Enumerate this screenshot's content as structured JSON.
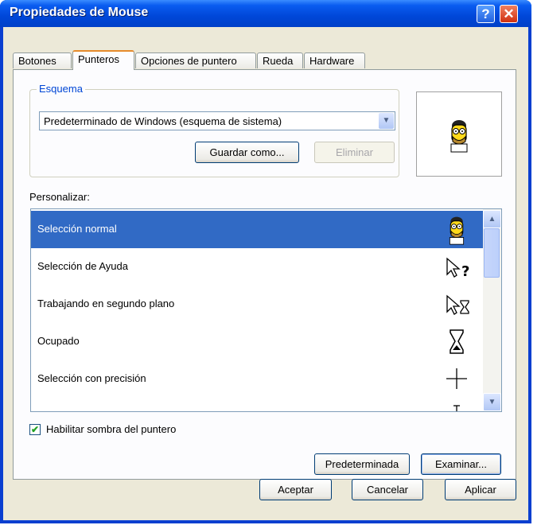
{
  "window": {
    "title": "Propiedades de Mouse"
  },
  "title_buttons": {
    "help": "?",
    "close": "✕"
  },
  "tabs": [
    {
      "label": "Botones"
    },
    {
      "label": "Punteros"
    },
    {
      "label": "Opciones de puntero"
    },
    {
      "label": "Rueda"
    },
    {
      "label": "Hardware"
    }
  ],
  "scheme": {
    "group_label": "Esquema",
    "selected": "Predeterminado de Windows (esquema de sistema)",
    "save_as_label": "Guardar como...",
    "delete_label": "Eliminar"
  },
  "customize": {
    "label": "Personalizar:",
    "items": [
      {
        "label": "Selección normal",
        "icon": "homer-cursor-icon"
      },
      {
        "label": "Selección de Ayuda",
        "icon": "help-select-cursor-icon"
      },
      {
        "label": "Trabajando en segundo plano",
        "icon": "working-background-cursor-icon"
      },
      {
        "label": "Ocupado",
        "icon": "hourglass-cursor-icon"
      },
      {
        "label": "Selección con precisión",
        "icon": "crosshair-cursor-icon"
      },
      {
        "label": "",
        "icon": "text-select-cursor-icon"
      }
    ]
  },
  "shadow_checkbox": {
    "label": "Habilitar sombra del puntero",
    "checked": true
  },
  "default_button_label": "Predeterminada",
  "browse_button_label": "Examinar...",
  "footer": {
    "ok": "Aceptar",
    "cancel": "Cancelar",
    "apply": "Aplicar"
  },
  "colors": {
    "title_bar": "#0a5cf0",
    "selection": "#316ac5",
    "face": "#ece9d8",
    "tab_accent": "#e68b2c"
  }
}
